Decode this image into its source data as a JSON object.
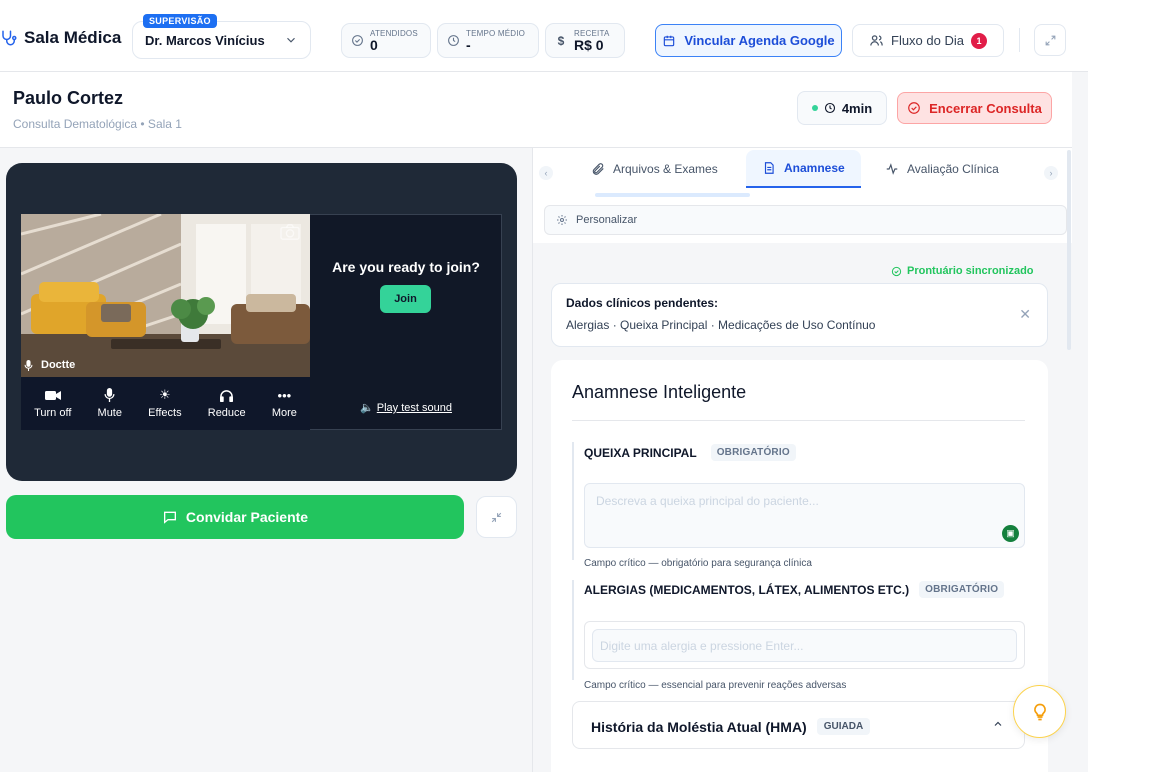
{
  "topbar": {
    "brand": "Sala Médica",
    "supervision_badge": "SUPERVISÃO",
    "doctor": "Dr. Marcos Vinícius",
    "stats": [
      {
        "label": "ATENDIDOS",
        "value": "0",
        "icon": "check-circle-icon"
      },
      {
        "label": "TEMPO MÉDIO",
        "value": "-",
        "icon": "clock-icon"
      },
      {
        "label": "RECEITA",
        "value": "R$ 0",
        "icon": "dollar-icon"
      }
    ],
    "google_button": "Vincular Agenda Google",
    "flow_button": "Fluxo do Dia",
    "flow_count": "1"
  },
  "patient": {
    "name": "Paulo Cortez",
    "subtitle": "Consulta Dematológica • Sala 1",
    "timer": "4min",
    "end_button": "Encerrar Consulta"
  },
  "video": {
    "participant": "Doctte",
    "controls": [
      {
        "label": "Turn off",
        "icon": "camera-icon"
      },
      {
        "label": "Mute",
        "icon": "mic-icon"
      },
      {
        "label": "Effects",
        "icon": "sparkle-icon"
      },
      {
        "label": "Reduce",
        "icon": "headphones-icon"
      },
      {
        "label": "More",
        "icon": "more-icon"
      }
    ],
    "ready_text": "Are you ready to join?",
    "join_button": "Join",
    "test_sound": "Play test sound",
    "invite_button": "Convidar Paciente"
  },
  "tabs": [
    {
      "label": "Arquivos & Exames",
      "icon": "paperclip-icon"
    },
    {
      "label": "Anamnese",
      "icon": "document-icon",
      "active": true
    },
    {
      "label": "Avaliação Clínica",
      "icon": "pulse-icon"
    }
  ],
  "personalize": "Personalizar",
  "sync_status": "Prontuário sincronizado",
  "pending": {
    "title": "Dados clínicos pendentes:",
    "items": "Alergias · Queixa Principal · Medicações de Uso Contínuo"
  },
  "form": {
    "title": "Anamnese Inteligente",
    "chief_complaint": {
      "label": "QUEIXA PRINCIPAL",
      "badge": "OBRIGATÓRIO",
      "placeholder": "Descreva a queixa principal do paciente...",
      "hint": "Campo crítico — obrigatório para segurança clínica"
    },
    "allergies": {
      "label": "ALERGIAS (MEDICAMENTOS, LÁTEX, ALIMENTOS ETC.)",
      "badge": "OBRIGATÓRIO",
      "placeholder": "Digite uma alergia e pressione Enter...",
      "hint": "Campo crítico — essencial para prevenir reações adversas"
    },
    "hma": {
      "title": "História da Moléstia Atual (HMA)",
      "badge": "GUIADA"
    }
  }
}
